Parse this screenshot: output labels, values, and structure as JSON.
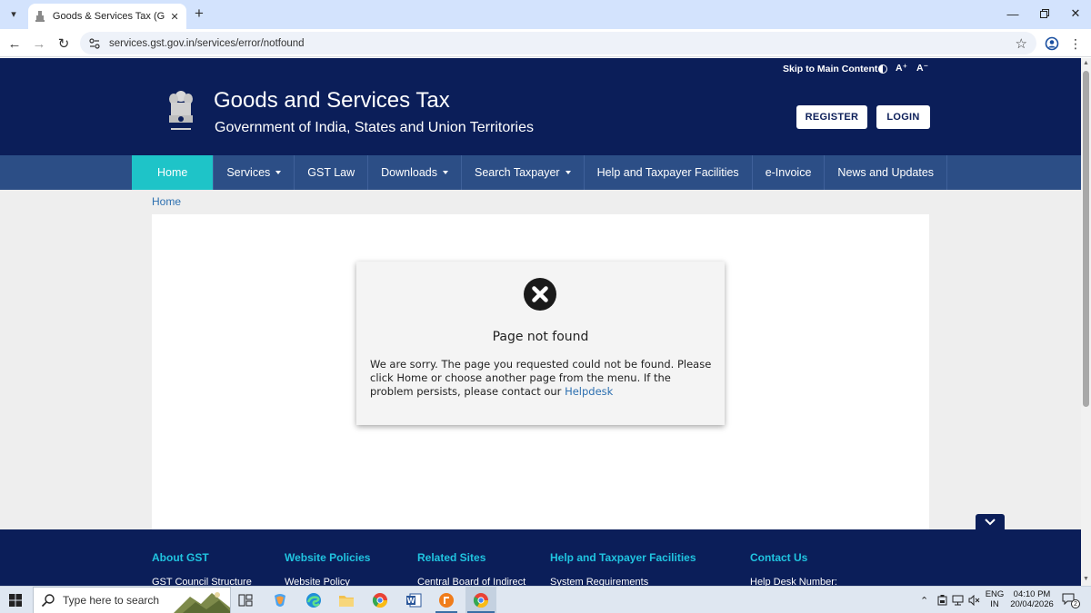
{
  "browser": {
    "tab_title": "Goods & Services Tax (GST) | N",
    "url": "services.gst.gov.in/services/error/notfound",
    "icons": [
      "tab-search-icon",
      "gst-favicon-icon",
      "close-icon",
      "plus-icon",
      "minimize-icon",
      "restore-icon",
      "window-close-icon",
      "back-icon",
      "forward-icon",
      "reload-icon",
      "site-info-icon",
      "bookmark-star-icon",
      "profile-icon",
      "more-menu-icon"
    ]
  },
  "accessibility": {
    "skip_link": "Skip to Main Content",
    "font_increase": "A⁺",
    "font_decrease": "A⁻"
  },
  "header": {
    "title": "Goods and Services Tax",
    "subtitle": "Government of India, States and Union Territories",
    "register_label": "REGISTER",
    "login_label": "LOGIN"
  },
  "nav": {
    "items": [
      {
        "label": "Home",
        "has_dropdown": false,
        "active": true
      },
      {
        "label": "Services",
        "has_dropdown": true
      },
      {
        "label": "GST Law",
        "has_dropdown": false
      },
      {
        "label": "Downloads",
        "has_dropdown": true
      },
      {
        "label": "Search Taxpayer",
        "has_dropdown": true
      },
      {
        "label": "Help and Taxpayer Facilities",
        "has_dropdown": false
      },
      {
        "label": "e-Invoice",
        "has_dropdown": false
      },
      {
        "label": "News and Updates",
        "has_dropdown": false
      }
    ]
  },
  "breadcrumb": {
    "home": "Home"
  },
  "error": {
    "title": "Page not found",
    "message": "We are sorry. The page you requested could not be found. Please click Home or choose another page from the menu. If the problem persists, please contact our",
    "link_label": "Helpdesk"
  },
  "footer": {
    "columns": [
      {
        "heading": "About GST",
        "first_link": "GST Council Structure"
      },
      {
        "heading": "Website Policies",
        "first_link": "Website Policy"
      },
      {
        "heading": "Related Sites",
        "first_link": "Central Board of Indirect"
      },
      {
        "heading": "Help and Taxpayer Facilities",
        "first_link": "System Requirements"
      },
      {
        "heading": "Contact Us",
        "first_link": "Help Desk Number:"
      }
    ]
  },
  "taskbar": {
    "search_placeholder": "Type here to search",
    "language_line1": "ENG",
    "language_line2": "IN",
    "time": "04:10 PM",
    "date": "20/04/2026",
    "notification_count": "2"
  },
  "colors": {
    "header_bg": "#0b1e59",
    "menu_bg": "#2c4e86",
    "menu_active": "#1ec4c8",
    "footer_heading": "#20c4e0",
    "link": "#2c6fb0"
  }
}
